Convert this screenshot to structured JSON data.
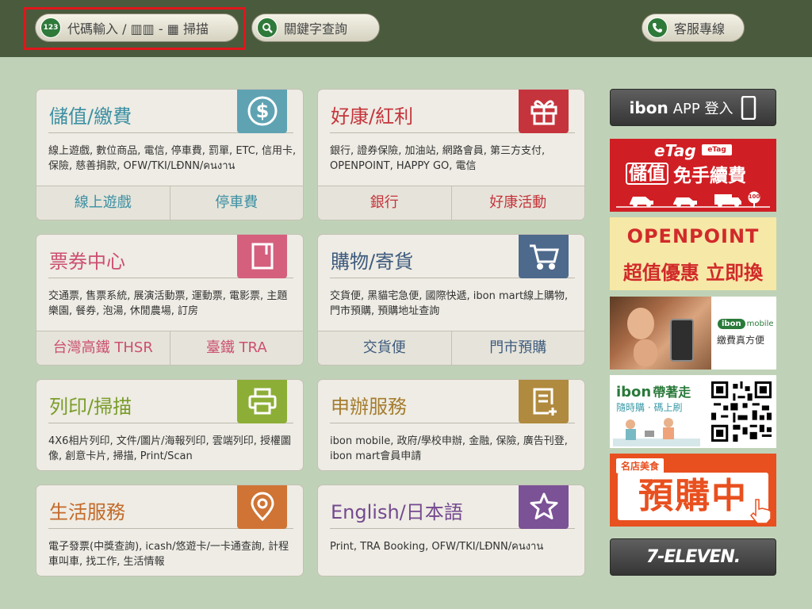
{
  "topbar": {
    "code_badge": "123",
    "code_input_label": "代碼輸入 / ▥▥ - ▦ 掃描",
    "keyword_search_label": "關鍵字查詢",
    "support_label": "客服專線"
  },
  "cards": {
    "stored_value": {
      "title": "儲值/繳費",
      "desc": "線上遊戲, 數位商品, 電信, 停車費, 罰單, ETC, 信用卡, 保險, 慈善捐款, OFW/TKI/LĐNN/คนงาน",
      "subs": [
        "線上遊戲",
        "停車費"
      ],
      "color": "#5fa3b3"
    },
    "offers": {
      "title": "好康/紅利",
      "desc": "銀行, 證券保險, 加油站, 網路會員, 第三方支付, OPENPOINT, HAPPY GO, 電信",
      "subs": [
        "銀行",
        "好康活動"
      ],
      "color": "#c5343c"
    },
    "tickets": {
      "title": "票券中心",
      "desc": "交通票, 售票系統, 展演活動票, 運動票, 電影票, 主題樂園, 餐券, 泡湯, 休閒農場, 訂房",
      "subs": [
        "台灣高鐵 THSR",
        "臺鐵 TRA"
      ],
      "color": "#d4607e"
    },
    "shopping": {
      "title": "購物/寄貨",
      "desc": "交貨便, 黑貓宅急便, 國際快遞, ibon mart線上購物, 門市預購, 預購地址查詢",
      "subs": [
        "交貨便",
        "門市預購"
      ],
      "color": "#4d6a8c"
    },
    "print": {
      "title": "列印/掃描",
      "desc": "4X6相片列印, 文件/圖片/海報列印, 雲端列印, 授權圖像, 創意卡片, 掃描, Print/Scan",
      "color": "#8cae36"
    },
    "apply": {
      "title": "申辦服務",
      "desc": "ibon mobile, 政府/學校申辦, 金融, 保險, 廣告刊登, ibon mart會員申請",
      "color": "#b08a3e"
    },
    "life": {
      "title": "生活服務",
      "desc": "電子發票(中獎查詢), icash/悠遊卡/一卡通查詢, 計程車叫車, 找工作, 生活情報",
      "color": "#cf7435"
    },
    "english": {
      "title": "English/日本語",
      "desc": "Print, TRA Booking, OFW/TKI/LĐNN/คนงาน",
      "color": "#7b5296"
    }
  },
  "sidebar": {
    "app_login": {
      "brand": "ibon",
      "label": "APP 登入"
    },
    "etag": {
      "logo": "eTag",
      "mini": "eTag",
      "line1_a": "儲值",
      "line1_b": "免手續費",
      "sign": "100"
    },
    "openpoint": {
      "line1": "OPENPOINT",
      "line2": "超值優惠 立即換"
    },
    "ibon_mobile": {
      "brand": "ibon",
      "brand2": "mobile",
      "label": "繳費真方便"
    },
    "ibon_carry": {
      "brand": "ibon",
      "line1": "帶著走",
      "line2": "隨時購 · 碼上刷"
    },
    "preorder": {
      "tag": "名店美食",
      "label": "預購中"
    },
    "seven_eleven": "7-ELEVEN."
  }
}
